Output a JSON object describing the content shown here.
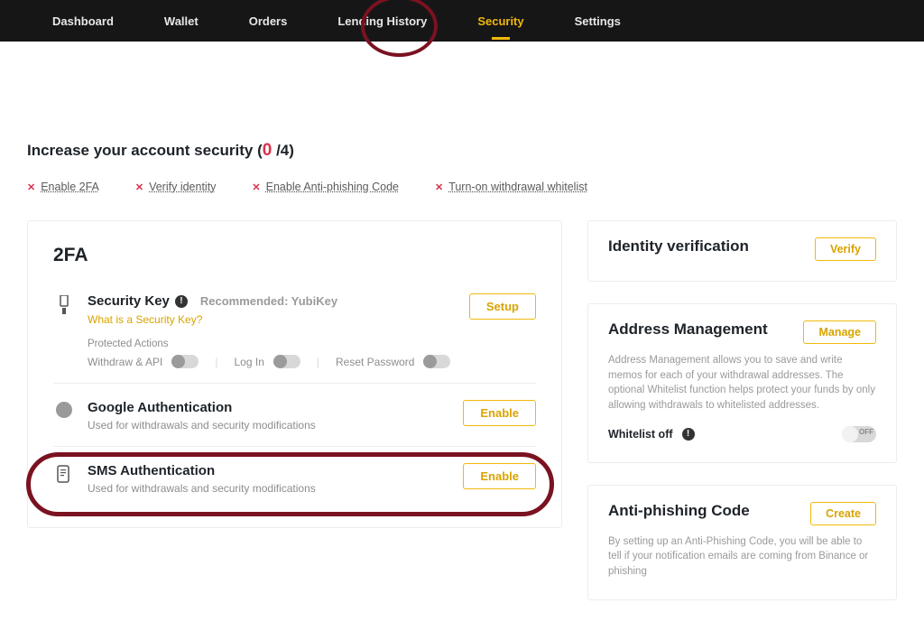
{
  "nav": {
    "items": [
      "Dashboard",
      "Wallet",
      "Orders",
      "Lending History",
      "Security",
      "Settings"
    ],
    "active_index": 4
  },
  "headline": {
    "prefix": "Increase your account security (",
    "current": "0",
    "suffix": " /4)"
  },
  "actions": [
    {
      "label": "Enable 2FA"
    },
    {
      "label": "Verify identity"
    },
    {
      "label": "Enable Anti-phishing Code"
    },
    {
      "label": "Turn-on withdrawal whitelist"
    }
  ],
  "twofa": {
    "title": "2FA",
    "security_key": {
      "title": "Security Key",
      "recommended": "Recommended: YubiKey",
      "what_is": "What is a Security Key?",
      "button": "Setup",
      "protected_label": "Protected Actions",
      "toggles": [
        "Withdraw & API",
        "Log In",
        "Reset Password"
      ]
    },
    "google": {
      "title": "Google Authentication",
      "desc": "Used for withdrawals and security modifications",
      "button": "Enable"
    },
    "sms": {
      "title": "SMS Authentication",
      "desc": "Used for withdrawals and security modifications",
      "button": "Enable"
    }
  },
  "identity": {
    "title": "Identity verification",
    "button": "Verify"
  },
  "address": {
    "title": "Address Management",
    "button": "Manage",
    "desc": "Address Management allows you to save and write memos for each of your withdrawal addresses. The optional Whitelist function helps protect your funds by only allowing withdrawals to whitelisted addresses.",
    "whitelist_label": "Whitelist off",
    "toggle_text": "OFF"
  },
  "antiphish": {
    "title": "Anti-phishing Code",
    "button": "Create",
    "desc": "By setting up an Anti-Phishing Code, you will be able to tell if your notification emails are coming from Binance or phishing"
  }
}
